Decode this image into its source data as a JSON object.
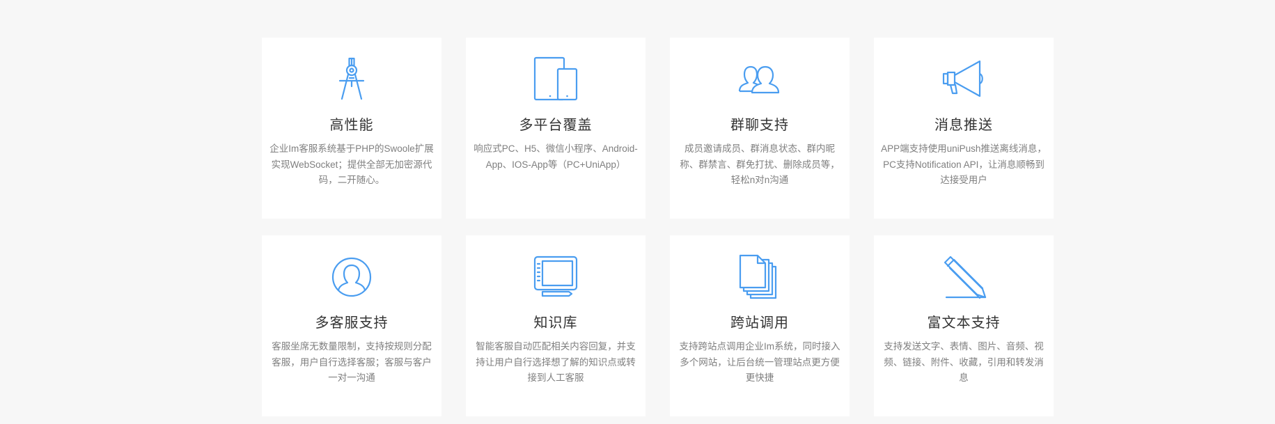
{
  "accent_color": "#4a9df0",
  "features": [
    {
      "icon": "compass-icon",
      "title": "高性能",
      "desc": "企业Im客服系统基于PHP的Swoole扩展实现WebSocket；提供全部无加密源代码，二开随心。"
    },
    {
      "icon": "multi-device-icon",
      "title": "多平台覆盖",
      "desc": "响应式PC、H5、微信小程序、Android-App、IOS-App等（PC+UniApp）"
    },
    {
      "icon": "users-group-icon",
      "title": "群聊支持",
      "desc": "成员邀请成员、群消息状态、群内昵称、群禁言、群免打扰、删除成员等，轻松n对n沟通"
    },
    {
      "icon": "megaphone-icon",
      "title": "消息推送",
      "desc": "APP端支持使用uniPush推送离线消息，PC支持Notification API，让消息顺畅到达接受用户"
    },
    {
      "icon": "user-circle-icon",
      "title": "多客服支持",
      "desc": "客服坐席无数量限制，支持按规则分配客服，用户自行选择客服；客服与客户一对一沟通"
    },
    {
      "icon": "tablet-pen-icon",
      "title": "知识库",
      "desc": "智能客服自动匹配相关内容回复，并支持让用户自行选择想了解的知识点或转接到人工客服"
    },
    {
      "icon": "documents-stack-icon",
      "title": "跨站调用",
      "desc": "支持跨站点调用企业Im系统，同时接入多个网站，让后台统一管理站点更方便更快捷"
    },
    {
      "icon": "pencil-icon",
      "title": "富文本支持",
      "desc": "支持发送文字、表情、图片、音频、视频、链接、附件、收藏，引用和转发消息"
    }
  ]
}
